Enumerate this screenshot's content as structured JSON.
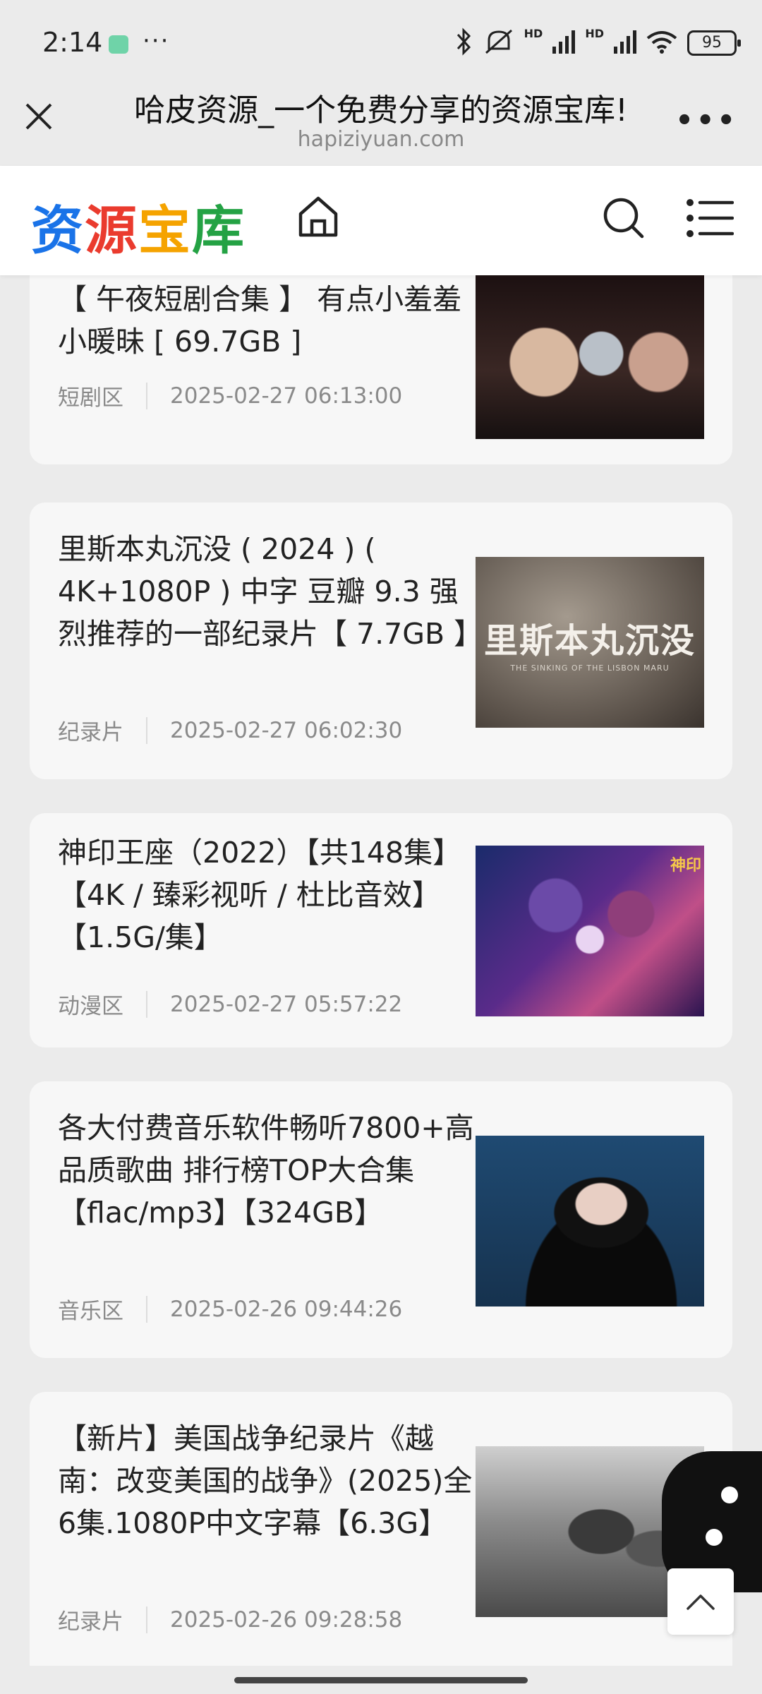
{
  "status_bar": {
    "time": "2:14",
    "more": "···",
    "hd_label": "HD",
    "battery": "95"
  },
  "browser": {
    "page_title": "哈皮资源_一个免费分享的资源宝库!",
    "url": "hapiziyuan.com",
    "menu_glyph": "•••"
  },
  "site": {
    "logo": [
      "资",
      "源",
      "宝",
      "库"
    ],
    "logo_colors": [
      "#1a73e8",
      "#ea3b2e",
      "#f5a300",
      "#24a244"
    ]
  },
  "posts": [
    {
      "title": "【 午夜短剧合集 】 有点小羞羞 小暖昧 [ 69.7GB ]",
      "category": "短剧区",
      "date": "2025-02-27 06:13:00"
    },
    {
      "title": "里斯本丸沉没 ( 2024 ) ( 4K+1080P ) 中字 豆瓣 9.3 强烈推荐的一部纪录片【 7.7GB 】",
      "category": "纪录片",
      "date": "2025-02-27 06:02:30",
      "thumb_text": "里斯本丸沉没",
      "thumb_subtext": "THE SINKING OF THE LISBON MARU"
    },
    {
      "title": "神印王座（2022）【共148集】【4K / 臻彩视听 / 杜比音效】【1.5G/集】",
      "category": "动漫区",
      "date": "2025-02-27 05:57:22",
      "thumb_text": "神印"
    },
    {
      "title": "各大付费音乐软件畅听7800+高品质歌曲 排行榜TOP大合集【flac/mp3】【324GB】",
      "category": "音乐区",
      "date": "2025-02-26 09:44:26"
    },
    {
      "title": "【新片】美国战争纪录片《越南：改变美国的战争》(2025)全6集.1080P中文字幕【6.3G】",
      "category": "纪录片",
      "date": "2025-02-26 09:28:58"
    }
  ]
}
